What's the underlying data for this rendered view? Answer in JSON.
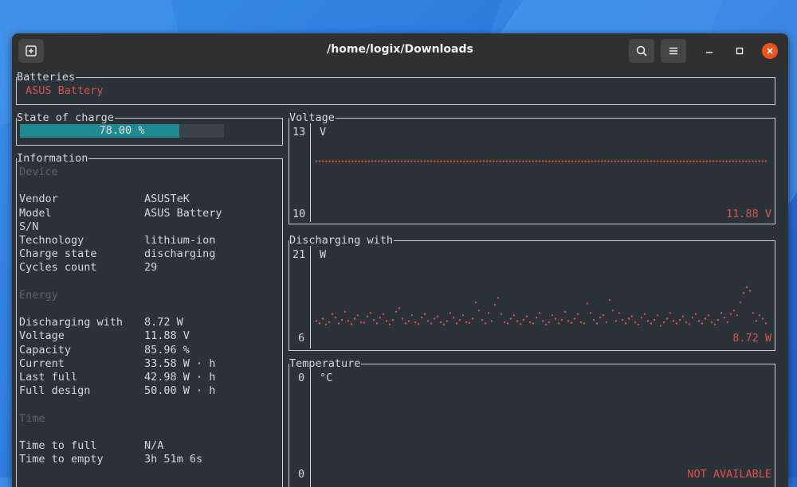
{
  "window": {
    "title": "/home/logix/Downloads"
  },
  "batteries": {
    "title": "Batteries",
    "selected": "ASUS Battery"
  },
  "state_of_charge": {
    "title": "State of charge",
    "label": "78.00 %",
    "fraction": 0.78
  },
  "information": {
    "title": "Information",
    "sections": [
      {
        "header": "Device",
        "rows": [
          {
            "key": "Vendor",
            "value": "ASUSTeK"
          },
          {
            "key": "Model",
            "value": "ASUS Battery"
          },
          {
            "key": "S/N",
            "value": ""
          },
          {
            "key": "Technology",
            "value": "lithium-ion"
          },
          {
            "key": "Charge state",
            "value": "discharging"
          },
          {
            "key": "Cycles count",
            "value": "29"
          }
        ]
      },
      {
        "header": "Energy",
        "rows": [
          {
            "key": "Discharging with",
            "value": "8.72 W"
          },
          {
            "key": "Voltage",
            "value": "11.88 V"
          },
          {
            "key": "Capacity",
            "value": "85.96 %"
          },
          {
            "key": "Current",
            "value": "33.58 W · h"
          },
          {
            "key": "Last full",
            "value": "42.98 W · h"
          },
          {
            "key": "Full design",
            "value": "50.00 W · h"
          }
        ]
      },
      {
        "header": "Time",
        "rows": [
          {
            "key": "Time to full",
            "value": "N/A"
          },
          {
            "key": "Time to empty",
            "value": "3h 51m 6s"
          }
        ]
      }
    ]
  },
  "charts": {
    "voltage": {
      "title": "Voltage",
      "ymax": "13",
      "ymin": "10",
      "unit": "V",
      "current": "11.88 V"
    },
    "discharging": {
      "title": "Discharging with",
      "ymax": "21",
      "ymin": "6",
      "unit": "W",
      "current": "8.72 W"
    },
    "temperature": {
      "title": "Temperature",
      "ymax": "0",
      "ymin": "0",
      "unit": "°C",
      "current": "NOT AVAILABLE"
    }
  },
  "chart_data": [
    {
      "type": "scatter",
      "title": "Voltage",
      "ylabel": "V",
      "ylim": [
        10,
        13
      ],
      "y": [
        11.88,
        11.88,
        11.88,
        11.88,
        11.88,
        11.88,
        11.88,
        11.88,
        11.88,
        11.88,
        11.88,
        11.88,
        11.88,
        11.88,
        11.88,
        11.88,
        11.88,
        11.88,
        11.88,
        11.88,
        11.88,
        11.88,
        11.88,
        11.88,
        11.88,
        11.88,
        11.88,
        11.88,
        11.88,
        11.88,
        11.88,
        11.88,
        11.88,
        11.88,
        11.88,
        11.88,
        11.88,
        11.88,
        11.88,
        11.88,
        11.88,
        11.88,
        11.88,
        11.88,
        11.88,
        11.88,
        11.88,
        11.88,
        11.88,
        11.88,
        11.88,
        11.88,
        11.88,
        11.88,
        11.88,
        11.88,
        11.88,
        11.88,
        11.88,
        11.88,
        11.88,
        11.88,
        11.88,
        11.88,
        11.88,
        11.88,
        11.88,
        11.88,
        11.88,
        11.88,
        11.88,
        11.88,
        11.88,
        11.88,
        11.88,
        11.88,
        11.88,
        11.88,
        11.88,
        11.88,
        11.88,
        11.88,
        11.88,
        11.88,
        11.88,
        11.88,
        11.88,
        11.88,
        11.88,
        11.88,
        11.88,
        11.88,
        11.88,
        11.88,
        11.88,
        11.88,
        11.88,
        11.88,
        11.88,
        11.88,
        11.88,
        11.88,
        11.88,
        11.88,
        11.88,
        11.88,
        11.88,
        11.88,
        11.88,
        11.88,
        11.88,
        11.88,
        11.88,
        11.88,
        11.88,
        11.88,
        11.88,
        11.88,
        11.88,
        11.88,
        11.88,
        11.88,
        11.88,
        11.88,
        11.88,
        11.88,
        11.88,
        11.88,
        11.88,
        11.88,
        11.88,
        11.88,
        11.88,
        11.88,
        11.88,
        11.88,
        11.88,
        11.88
      ]
    },
    {
      "type": "scatter",
      "title": "Discharging with",
      "ylabel": "W",
      "ylim": [
        6,
        21
      ],
      "y": [
        9.2,
        8.8,
        9.6,
        8.6,
        9.0,
        10.4,
        9.8,
        8.8,
        9.4,
        10.8,
        9.2,
        8.7,
        9.6,
        10.2,
        9.0,
        8.9,
        10.0,
        10.6,
        9.4,
        8.8,
        9.8,
        10.4,
        9.2,
        8.6,
        9.4,
        10.8,
        11.4,
        9.6,
        8.8,
        9.2,
        10.2,
        9.0,
        8.7,
        9.8,
        10.4,
        9.2,
        8.8,
        9.6,
        10.0,
        9.0,
        8.6,
        9.2,
        10.6,
        9.8,
        8.8,
        9.4,
        10.2,
        9.0,
        8.9,
        9.6,
        12.4,
        11.0,
        9.4,
        8.8,
        10.6,
        9.2,
        12.0,
        13.2,
        10.4,
        9.0,
        8.8,
        9.6,
        10.2,
        9.2,
        8.7,
        9.4,
        10.0,
        9.0,
        8.8,
        9.8,
        10.6,
        9.2,
        8.6,
        9.0,
        10.2,
        9.6,
        8.8,
        9.4,
        10.8,
        9.2,
        8.9,
        9.6,
        10.4,
        9.0,
        8.8,
        12.2,
        10.6,
        9.4,
        8.8,
        9.8,
        10.2,
        9.0,
        12.8,
        11.0,
        9.2,
        10.6,
        9.4,
        8.8,
        9.6,
        10.0,
        9.0,
        8.6,
        9.8,
        10.4,
        9.2,
        8.8,
        9.4,
        10.2,
        8.4,
        9.0,
        9.6,
        10.6,
        9.2,
        8.8,
        9.4,
        10.0,
        9.0,
        8.7,
        9.8,
        10.4,
        9.2,
        8.8,
        9.6,
        10.2,
        9.0,
        8.6,
        9.4,
        10.6,
        9.8,
        9.0,
        10.4,
        11.0,
        10.2,
        12.4,
        14.0,
        15.0,
        14.4,
        10.6,
        9.2,
        10.2,
        9.6,
        8.8
      ]
    },
    {
      "type": "scatter",
      "title": "Temperature",
      "ylabel": "°C",
      "ylim": [
        0,
        0
      ],
      "y": []
    }
  ]
}
